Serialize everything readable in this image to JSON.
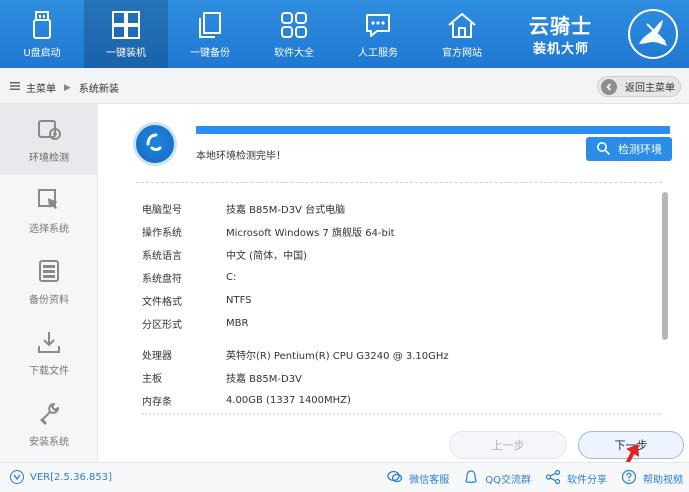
{
  "colors": {
    "top_bar": "#1f78d1",
    "accent": "#2a8de8",
    "sidebar_bg": "#f5f6f7",
    "breadcrumb_bg": "#f2f4f6",
    "footer_link": "#2a7ed6",
    "arrow_red": "#e02424"
  },
  "topnav": {
    "items": [
      {
        "label": "U盘启动",
        "icon": "usb-drive-icon"
      },
      {
        "label": "一键装机",
        "icon": "windows-grid-icon",
        "active": true
      },
      {
        "label": "一键备份",
        "icon": "copy-icon"
      },
      {
        "label": "软件大全",
        "icon": "apps-grid-icon"
      },
      {
        "label": "人工服务",
        "icon": "chat-bubble-icon"
      },
      {
        "label": "官方网站",
        "icon": "home-icon"
      }
    ]
  },
  "brand": {
    "name": "云骑士",
    "subtitle": "装机大师"
  },
  "breadcrumb": {
    "root": "主菜单",
    "current": "系统新装",
    "back_label": "返回主菜单"
  },
  "sidebar": {
    "items": [
      {
        "label": "环境检测",
        "icon": "environment-check-icon",
        "active": true
      },
      {
        "label": "选择系统",
        "icon": "select-system-icon"
      },
      {
        "label": "备份资料",
        "icon": "backup-data-icon"
      },
      {
        "label": "下载文件",
        "icon": "download-icon"
      },
      {
        "label": "安装系统",
        "icon": "install-wrench-icon"
      }
    ]
  },
  "detection": {
    "status": "本地环境检测完毕！",
    "progress_percent": 100,
    "detect_button": "检测环境"
  },
  "system_info": {
    "rows": [
      {
        "key": "电脑型号",
        "value": "技嘉 B85M-D3V 台式电脑"
      },
      {
        "key": "操作系统",
        "value": "Microsoft Windows 7 旗舰版  64-bit"
      },
      {
        "key": "系统语言",
        "value": "中文 (简体，中国)"
      },
      {
        "key": "系统盘符",
        "value": "C:"
      },
      {
        "key": "文件格式",
        "value": "NTFS"
      },
      {
        "key": "分区形式",
        "value": "MBR"
      },
      {
        "key": "处理器",
        "value": "英特尔(R) Pentium(R) CPU G3240 @ 3.10GHz"
      },
      {
        "key": "主板",
        "value": "技嘉 B85M-D3V"
      },
      {
        "key": "内存条",
        "value": "4.00GB (1337  1400MHZ)"
      }
    ]
  },
  "actions": {
    "prev": "上一步",
    "next": "下一步"
  },
  "footer": {
    "version": "VER[2.5.36.853]",
    "links": [
      {
        "label": "微信客服",
        "icon": "wechat-icon"
      },
      {
        "label": "QQ交流群",
        "icon": "qq-icon"
      },
      {
        "label": "软件分享",
        "icon": "share-icon"
      },
      {
        "label": "帮助视频",
        "icon": "help-icon"
      }
    ]
  }
}
